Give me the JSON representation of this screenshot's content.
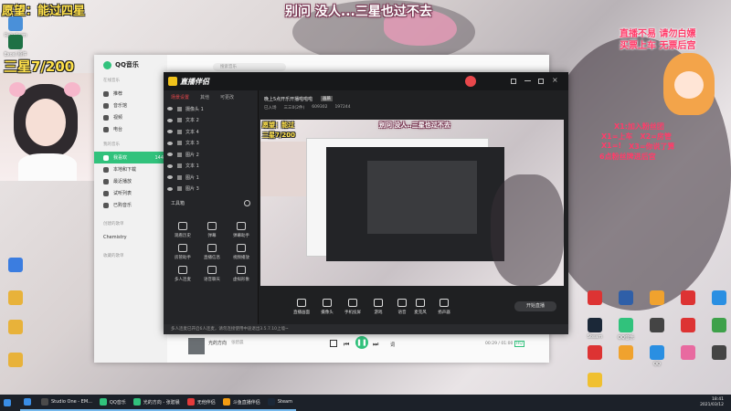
{
  "overlay": {
    "wish": "愿望：能过四星",
    "stars": "三星7/200",
    "banner": "别问 没人...三星也过不去",
    "right_note_line1": "直播不易 请勿白嫖",
    "right_note_line2": "买票上车 无票后宫",
    "rules": [
      "X1:加入粉丝团",
      "X1=上车",
      "X2=房管",
      "X1=!",
      "X3=你说了算",
      "6点粉丝牌进后宫"
    ]
  },
  "desktop_icons_left": [
    {
      "label": "Roboform",
      "color": "#4a90d9"
    },
    {
      "label": "Excel 原件",
      "color": "#1e7145"
    },
    {
      "label": "",
      "color": "#3b7de0"
    },
    {
      "label": "",
      "color": "#e8b23a"
    },
    {
      "label": "",
      "color": "#e8b23a"
    },
    {
      "label": "",
      "color": "#e8b23a"
    }
  ],
  "desktop_icons_right": [
    {
      "label": "",
      "color": "#dd3333"
    },
    {
      "label": "",
      "color": "#2f5fa8"
    },
    {
      "label": "",
      "color": "#f0a22e"
    },
    {
      "label": "",
      "color": "#dd3333"
    },
    {
      "label": "",
      "color": "#2a8fe2"
    },
    {
      "label": "Steam",
      "color": "#1b2838"
    },
    {
      "label": "QQ音乐",
      "color": "#31c27c"
    },
    {
      "label": "",
      "color": "#444"
    },
    {
      "label": "",
      "color": "#dd3333"
    },
    {
      "label": "",
      "color": "#3ea14a"
    },
    {
      "label": "",
      "color": "#dd3333"
    },
    {
      "label": "",
      "color": "#f0a22e"
    },
    {
      "label": "QQ",
      "color": "#2a8fe2"
    },
    {
      "label": "",
      "color": "#e86aa0"
    },
    {
      "label": "",
      "color": "#444"
    },
    {
      "label": "",
      "color": "#f0c030"
    }
  ],
  "qqmusic": {
    "app_name": "QQ音乐",
    "search_placeholder": "搜索音乐",
    "online_section": "在线音乐",
    "online_items": [
      "推荐",
      "音乐馆",
      "视频",
      "电台"
    ],
    "my_section": "我的音乐",
    "my_items": [
      "我喜欢",
      "本地和下载",
      "最近播放",
      "试听列表",
      "已购音乐"
    ],
    "liked_count": "144",
    "created_section": "创建的歌单",
    "created_items": [
      "Chemistry"
    ],
    "collected_section": "收藏的歌单",
    "now_playing_title": "光的方向",
    "now_playing_artist": "张碧晨",
    "time": "00:29 / 01:00",
    "quality": "HQ",
    "lyrics": "词"
  },
  "zbbl": {
    "app_name": "直播伴侣",
    "tabs": [
      "场景设置",
      "其他",
      "可更改"
    ],
    "sources": [
      "摄像头 1",
      "文本 2",
      "文本 4",
      "文本 3",
      "图片 2",
      "文本 1",
      "图片 1",
      "图片 3"
    ],
    "toolbox_label": "工具箱",
    "tools": [
      "观看历史",
      "弹幕",
      "弹幕助手",
      "房管助手",
      "直播信息",
      "视频播放",
      "多人连麦",
      "语音聊天",
      "虚拟形象"
    ],
    "title": "晚上5点开乐开播啦啦啦",
    "title_tag": "画质",
    "stats": [
      "已入场",
      "三三0(2件)",
      "609302",
      "197244"
    ],
    "bottom_buttons": [
      "直播画面",
      "摄像头",
      "手机投屏",
      "游戏",
      "语音",
      "麦克风",
      "扬声器"
    ],
    "start_button": "开始直播",
    "status_text": "多人连麦已开启6人连麦，请勿连接使用中途退出3.5.7.10上墙~",
    "preview_wish": "愿望：能过",
    "preview_stars": "三星7/200",
    "preview_banner": "别问 没人..三星也过不去"
  },
  "taskbar": {
    "items": [
      {
        "label": "",
        "color": "#3a8ee6"
      },
      {
        "label": "Studio One - EM...",
        "color": "#4a4a4a"
      },
      {
        "label": "QQ音乐",
        "color": "#31c27c"
      },
      {
        "label": "光的方向 - 张碧晨",
        "color": "#31c27c"
      },
      {
        "label": "无他伴侣",
        "color": "#e23b3b"
      },
      {
        "label": "斗鱼直播伴侣",
        "color": "#f39c12"
      },
      {
        "label": "Steam",
        "color": "#1b2838"
      }
    ],
    "time": "18:41",
    "date": "2021/03/12"
  }
}
